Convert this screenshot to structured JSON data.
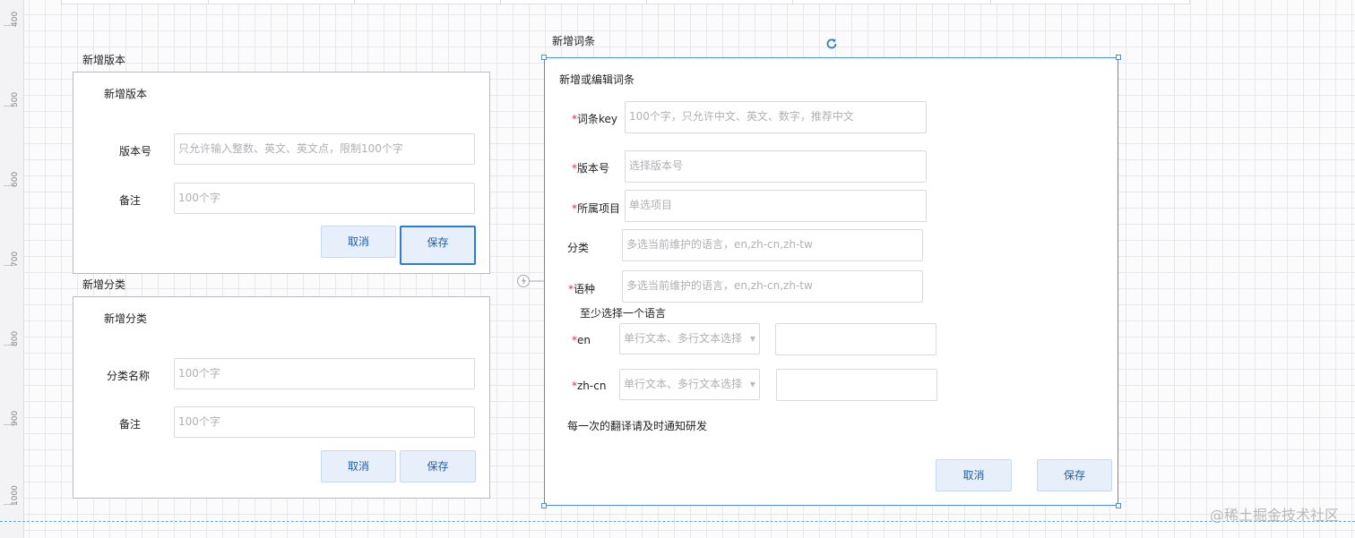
{
  "ruler": {
    "marks": [
      "400",
      "500",
      "600",
      "700",
      "800",
      "900",
      "1000"
    ]
  },
  "frames": {
    "version_label": "新增版本",
    "category_label": "新增分类",
    "term_label": "新增词条"
  },
  "version_dialog": {
    "title": "新增版本",
    "version_no_label": "版本号",
    "version_no_placeholder": "只允许输入整数、英文、英文点，限制100个字",
    "remark_label": "备注",
    "remark_placeholder": "100个字",
    "cancel_label": "取消",
    "save_label": "保存"
  },
  "category_dialog": {
    "title": "新增分类",
    "name_label": "分类名称",
    "name_placeholder": "100个字",
    "remark_label": "备注",
    "remark_placeholder": "100个字",
    "cancel_label": "取消",
    "save_label": "保存"
  },
  "term_dialog": {
    "title": "新增或编辑词条",
    "required_mark": "*",
    "key_label": "词条key",
    "key_placeholder": "100个字，只允许中文、英文、数字，推荐中文",
    "version_label": "版本号",
    "version_placeholder": "选择版本号",
    "project_label": "所属项目",
    "project_placeholder": "单选项目",
    "category_label": "分类",
    "category_placeholder": "多选当前维护的语言，en,zh-cn,zh-tw",
    "language_label": "语种",
    "language_placeholder": "多选当前维护的语言，en,zh-cn,zh-tw",
    "language_hint": "至少选择一个语言",
    "en_label": "en",
    "en_type_placeholder": "单行文本、多行文本选择",
    "zhcn_label": "zh-cn",
    "zhcn_type_placeholder": "单行文本、多行文本选择",
    "note": "每一次的翻译请及时通知研发",
    "cancel_label": "取消",
    "save_label": "保存"
  },
  "watermark": "@稀土掘金技术社区"
}
